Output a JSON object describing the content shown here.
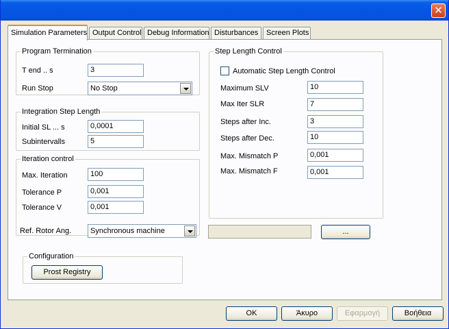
{
  "window": {
    "close_label": "✕"
  },
  "tabs": [
    {
      "label": "Simulation Parameters"
    },
    {
      "label": "Output Control"
    },
    {
      "label": "Debug Information"
    },
    {
      "label": "Disturbances"
    },
    {
      "label": "Screen Plots"
    }
  ],
  "program_termination": {
    "title": "Program Termination",
    "t_end_label": "T end .. s",
    "t_end_value": "3",
    "run_stop_label": "Run Stop",
    "run_stop_value": "No Stop"
  },
  "integration_step": {
    "title": "Integration Step Length",
    "initial_sl_label": "Initial SL ... s",
    "initial_sl_value": "0,0001",
    "subintervalls_label": "Subintervalls",
    "subintervalls_value": "5"
  },
  "iteration_control": {
    "title": "Iteration control",
    "max_iteration_label": "Max. Iteration",
    "max_iteration_value": "100",
    "tolerance_p_label": "Tolerance P",
    "tolerance_p_value": "0,001",
    "tolerance_v_label": "Tolerance V",
    "tolerance_v_value": "0,001"
  },
  "step_length_control": {
    "title": "Step Length Control",
    "auto_label": "Automatic Step Length Control",
    "maximum_slv_label": "Maximum SLV",
    "maximum_slv_value": "10",
    "max_iter_slr_label": "Max Iter  SLR",
    "max_iter_slr_value": "7",
    "steps_after_inc_label": "Steps after  Inc.",
    "steps_after_inc_value": "3",
    "steps_after_dec_label": "Steps after  Dec.",
    "steps_after_dec_value": "10",
    "max_mismatch_p_label": "Max. Mismatch P",
    "max_mismatch_p_value": "0,001",
    "max_mismatch_f_label": "Max. Mismatch F",
    "max_mismatch_f_value": "0,001"
  },
  "ref_rotor": {
    "label": "Ref. Rotor Ang.",
    "value": "Synchronous machine",
    "browse_label": "..."
  },
  "configuration": {
    "title": "Configuration",
    "button_label": "Prost Registry"
  },
  "footer": {
    "ok": "OK",
    "cancel": "Άκυρο",
    "apply": "Εφαρμογή",
    "help": "Βοήθεια"
  }
}
